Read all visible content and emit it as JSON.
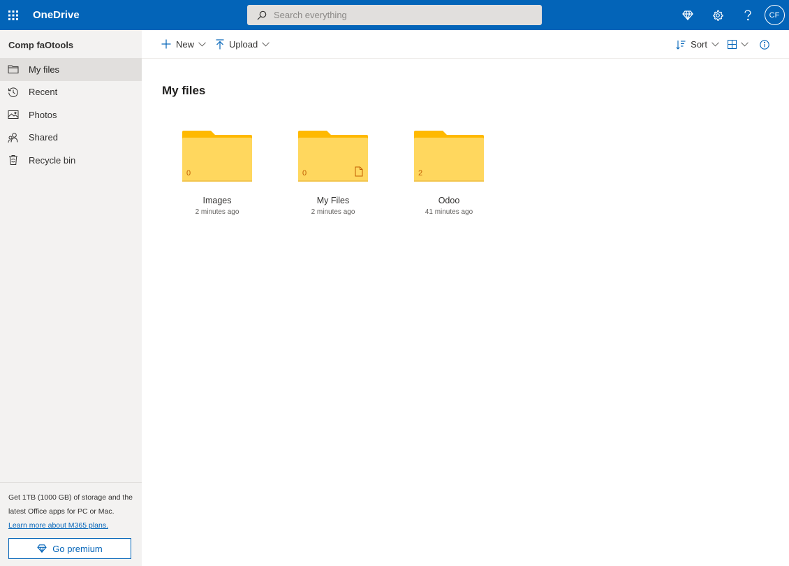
{
  "app": {
    "title": "OneDrive",
    "search_placeholder": "Search everything",
    "avatar_initials": "CF",
    "accent": "#0364b8"
  },
  "sidebar": {
    "account_name": "Comp faOtools",
    "items": [
      {
        "label": "My files",
        "icon": "folder-icon",
        "active": true
      },
      {
        "label": "Recent",
        "icon": "history-icon",
        "active": false
      },
      {
        "label": "Photos",
        "icon": "photo-icon",
        "active": false
      },
      {
        "label": "Shared",
        "icon": "people-icon",
        "active": false
      },
      {
        "label": "Recycle bin",
        "icon": "trash-icon",
        "active": false
      }
    ],
    "premium": {
      "text": "Get 1TB (1000 GB) of storage and the latest Office apps for PC or Mac.",
      "link": "Learn more about M365 plans.",
      "button": "Go premium"
    }
  },
  "toolbar": {
    "new_label": "New",
    "upload_label": "Upload",
    "sort_label": "Sort"
  },
  "main": {
    "title": "My files",
    "folders": [
      {
        "name": "Images",
        "modified": "2 minutes ago",
        "count": "0",
        "has_file_icon": false
      },
      {
        "name": "My Files",
        "modified": "2 minutes ago",
        "count": "0",
        "has_file_icon": true
      },
      {
        "name": "Odoo",
        "modified": "41 minutes ago",
        "count": "2",
        "has_file_icon": false
      }
    ]
  }
}
